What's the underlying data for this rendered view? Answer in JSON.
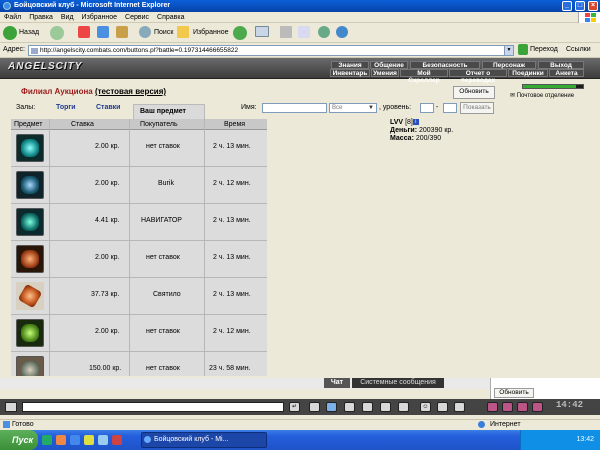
{
  "window": {
    "title": "Бойцовский клуб - Microsoft Internet Explorer"
  },
  "menu": [
    "Файл",
    "Правка",
    "Вид",
    "Избранное",
    "Сервис",
    "Справка"
  ],
  "toolbar": {
    "back": "Назад",
    "search": "Поиск",
    "favorites": "Избранное"
  },
  "address": {
    "label": "Адрес:",
    "url": "http://angelscity.combats.com/buttons.pl?battle=0.197314466655822",
    "go": "Переход",
    "links": "Ссылки"
  },
  "game": {
    "logo": "ANGELSCITY",
    "nav_top": [
      "Знания",
      "Общение",
      "Безопасность",
      "Персонаж",
      "Выход"
    ],
    "nav_bottom": [
      "Инвентарь",
      "Умения",
      "Мой Скроллер",
      "Отчет о переводах",
      "Поединки",
      "Анкета"
    ]
  },
  "auction": {
    "title": "Филиал Аукциона",
    "subtitle": "(тестовая версия)",
    "halls_label": "Залы:",
    "halls": [
      "Торги",
      "Ставки",
      "Ваш предмет"
    ],
    "name_label": "Имя:",
    "select_value": "Все",
    "level_label": ", уровень:",
    "dash": "-",
    "show_button": "Показать",
    "columns": [
      "Предмет",
      "Ставка",
      "Покупатель",
      "Время"
    ],
    "rows": [
      {
        "bid": "2.00 кр.",
        "buyer": "нет ставок",
        "time": "2 ч. 13 мин."
      },
      {
        "bid": "2.00 кр.",
        "buyer": "Burik",
        "time": "2 ч. 12 мин."
      },
      {
        "bid": "4.41 кр.",
        "buyer": "НАВИГАТОР",
        "time": "2 ч. 13 мин."
      },
      {
        "bid": "2.00 кр.",
        "buyer": "нет ставок",
        "time": "2 ч. 13 мин."
      },
      {
        "bid": "37.73 кр.",
        "buyer": "Святило",
        "time": "2 ч. 13 мин."
      },
      {
        "bid": "2.00 кр.",
        "buyer": "нет ставок",
        "time": "2 ч. 12 мин."
      },
      {
        "bid": "150.00 кр.",
        "buyer": "нет ставок",
        "time": "23 ч. 58 мин."
      }
    ]
  },
  "user": {
    "name": "LVV",
    "level": "[8]",
    "money_label": "Деньги:",
    "money": "200390",
    "currency": "кр.",
    "mass_label": "Масса:",
    "mass": "200/390"
  },
  "right": {
    "refresh": "Обновить",
    "post_office": "Почтовое отделение"
  },
  "chat": {
    "tab_chat": "Чат",
    "tab_system": "Системные сообщения",
    "refresh": "Обновить",
    "clock": "14:42"
  },
  "status": {
    "left": "Готово",
    "right": "Интернет"
  },
  "taskbar": {
    "start": "Пуск",
    "window": "Бойцовский клуб - Mi...",
    "time": "13:42"
  }
}
